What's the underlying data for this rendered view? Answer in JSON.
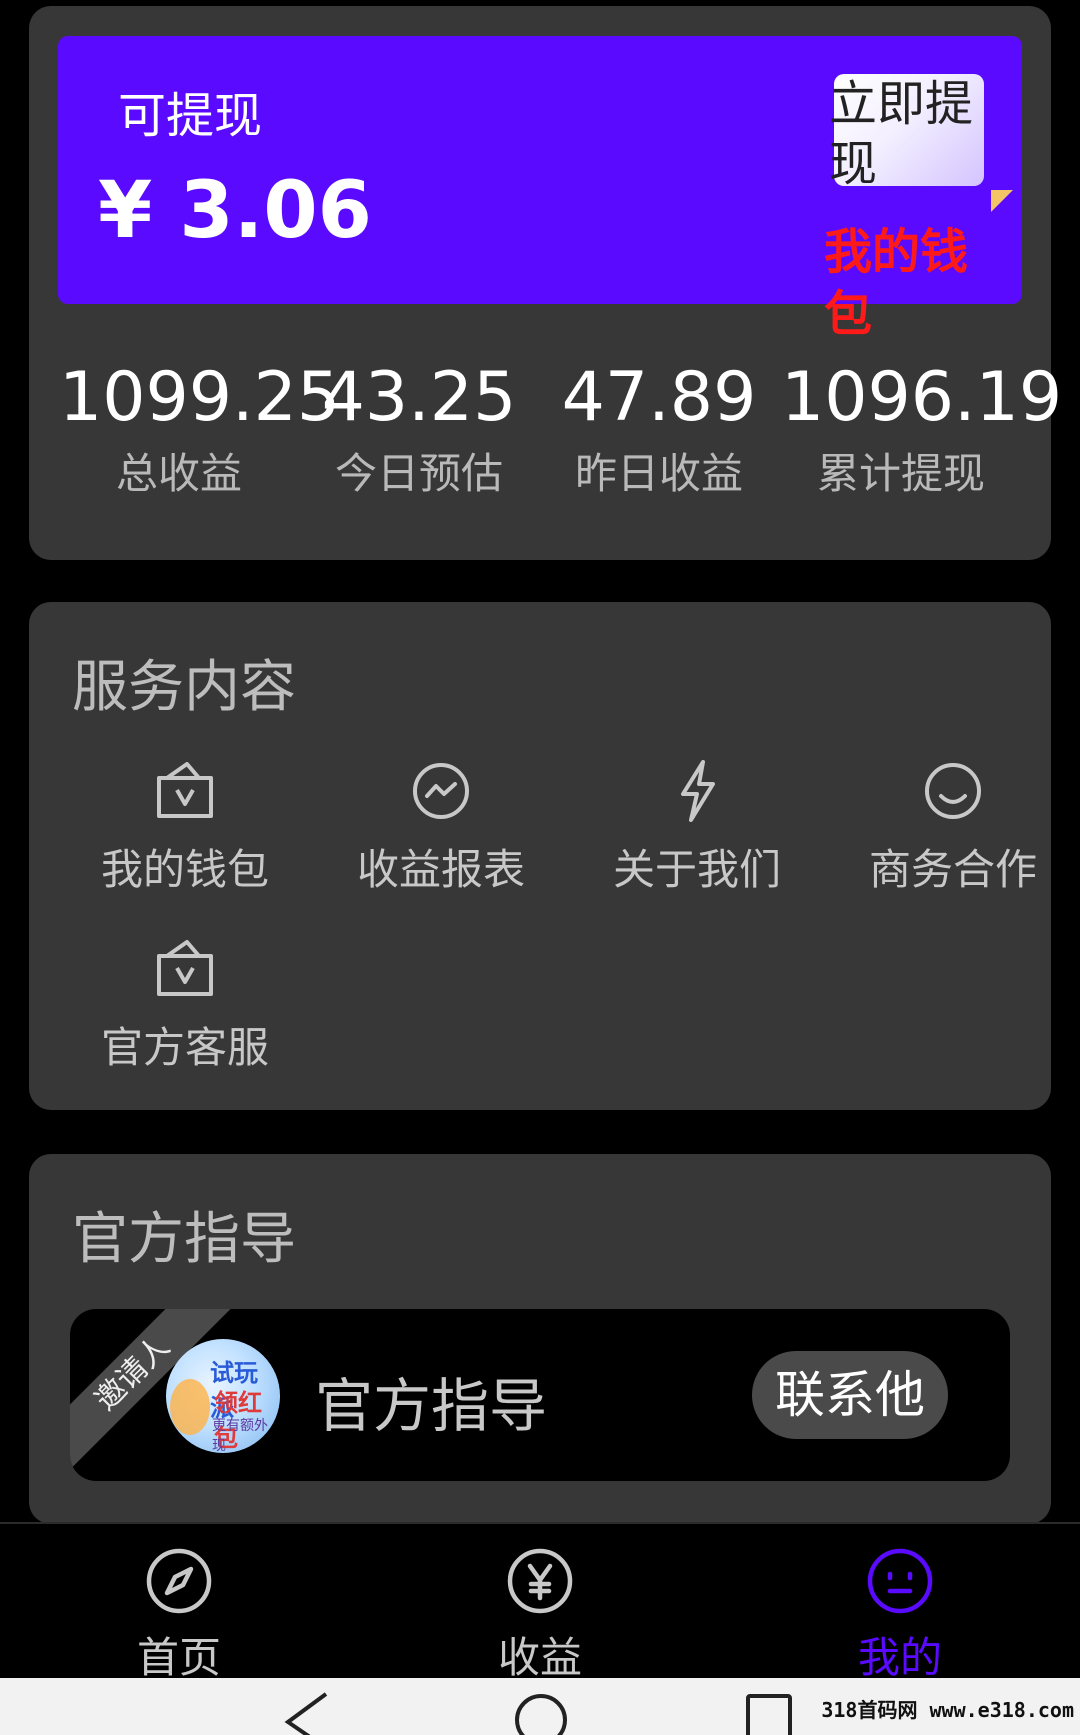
{
  "balance": {
    "label": "可提现",
    "amount": "¥ 3.06"
  },
  "withdraw_button": {
    "label": "立即提现"
  },
  "wallet_overlay": "我的钱包",
  "stats": [
    {
      "value": "1099.25",
      "label": "总收益"
    },
    {
      "value": "43.25",
      "label": "今日预估"
    },
    {
      "value": "47.89",
      "label": "昨日收益"
    },
    {
      "value": "1096.19",
      "label": "累计提现"
    }
  ],
  "services": {
    "title": "服务内容",
    "items": [
      {
        "label": "我的钱包",
        "icon": "wallet-icon"
      },
      {
        "label": "收益报表",
        "icon": "chart-icon"
      },
      {
        "label": "关于我们",
        "icon": "lightning-icon"
      },
      {
        "label": "商务合作",
        "icon": "smile-icon"
      },
      {
        "label": "官方客服",
        "icon": "wallet-icon"
      }
    ]
  },
  "guidance": {
    "title": "官方指导",
    "ribbon": "邀请人",
    "avatar_text": [
      "试玩派",
      "领红包",
      "更有额外现"
    ],
    "name": "官方指导",
    "contact_label": "联系他"
  },
  "tabs": [
    {
      "label": "首页",
      "icon": "compass-icon",
      "active": false
    },
    {
      "label": "收益",
      "icon": "yen-icon",
      "active": false
    },
    {
      "label": "我的",
      "icon": "face-icon",
      "active": true
    }
  ],
  "watermark": "318首码网 www.e318.com",
  "colors": {
    "accent": "#5a0aff",
    "card": "#373737",
    "overlay_red": "#ff1a1a"
  }
}
